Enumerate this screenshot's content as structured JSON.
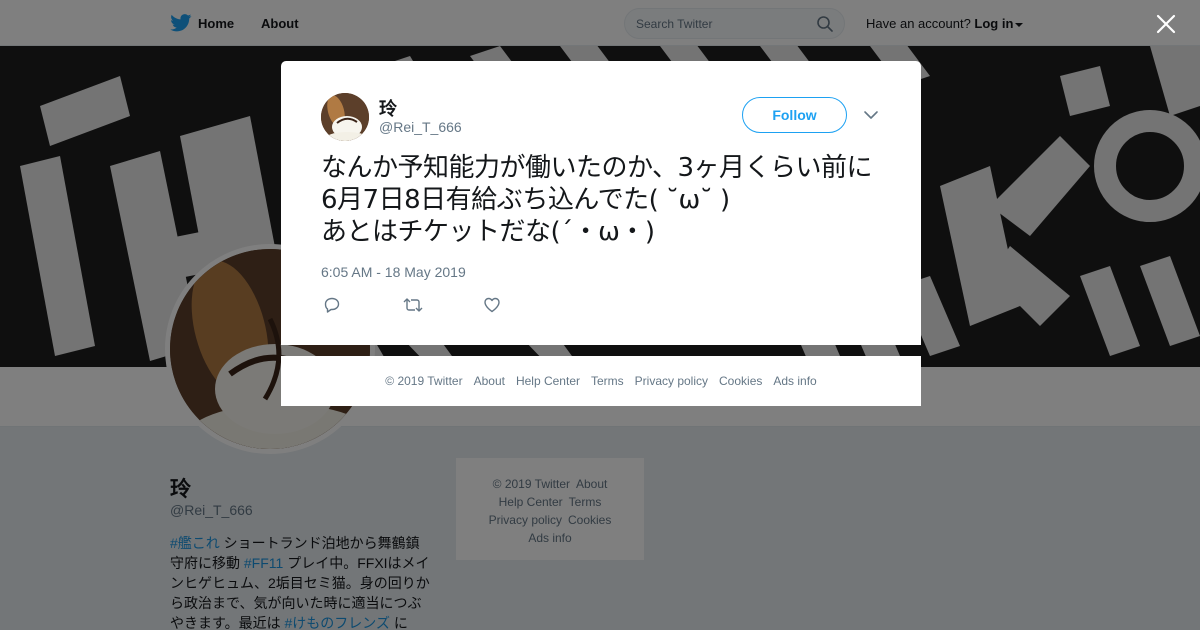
{
  "topbar": {
    "home_label": "Home",
    "about_label": "About",
    "search_placeholder": "Search Twitter",
    "account_prompt": "Have an account?",
    "login_label": "Log in"
  },
  "profile": {
    "name": "玲",
    "handle": "@Rei_T_666",
    "bio": [
      {
        "text": "#艦これ",
        "tag": true
      },
      {
        "text": " ショートランド泊地から舞鶴鎮守府に移動 ",
        "tag": false
      },
      {
        "text": "#FF11",
        "tag": true
      },
      {
        "text": " プレイ中。FFXIはメインヒゲヒュム、2垢目セミ猫。身の回りから政治まで、気が向いた時に適当につぶやきます。最近は ",
        "tag": false
      },
      {
        "text": "#けものフレンズ",
        "tag": true
      },
      {
        "text": " に",
        "tag": false
      }
    ]
  },
  "side_footer": {
    "lines": [
      [
        "© 2019 Twitter",
        "About"
      ],
      [
        "Help Center",
        "Terms"
      ],
      [
        "Privacy policy",
        "Cookies"
      ],
      [
        "Ads info"
      ]
    ]
  },
  "tweet": {
    "name": "玲",
    "handle": "@Rei_T_666",
    "follow_label": "Follow",
    "text": "なんか予知能力が働いたのか、3ヶ月くらい前に6月7日8日有給ぶち込んでた( ˘ω˘ )\n あとはチケットだな(´・ω・)",
    "timestamp": "6:05 AM - 18 May 2019"
  },
  "modal_footer": {
    "links": [
      "© 2019 Twitter",
      "About",
      "Help Center",
      "Terms",
      "Privacy policy",
      "Cookies",
      "Ads info"
    ]
  },
  "colors": {
    "brand": "#1da1f2",
    "link": "#1b95e0",
    "muted": "#657786"
  },
  "icons": [
    "twitter-bird-icon",
    "search-icon",
    "close-icon",
    "chevron-down-icon",
    "reply-icon",
    "retweet-icon",
    "like-icon"
  ]
}
